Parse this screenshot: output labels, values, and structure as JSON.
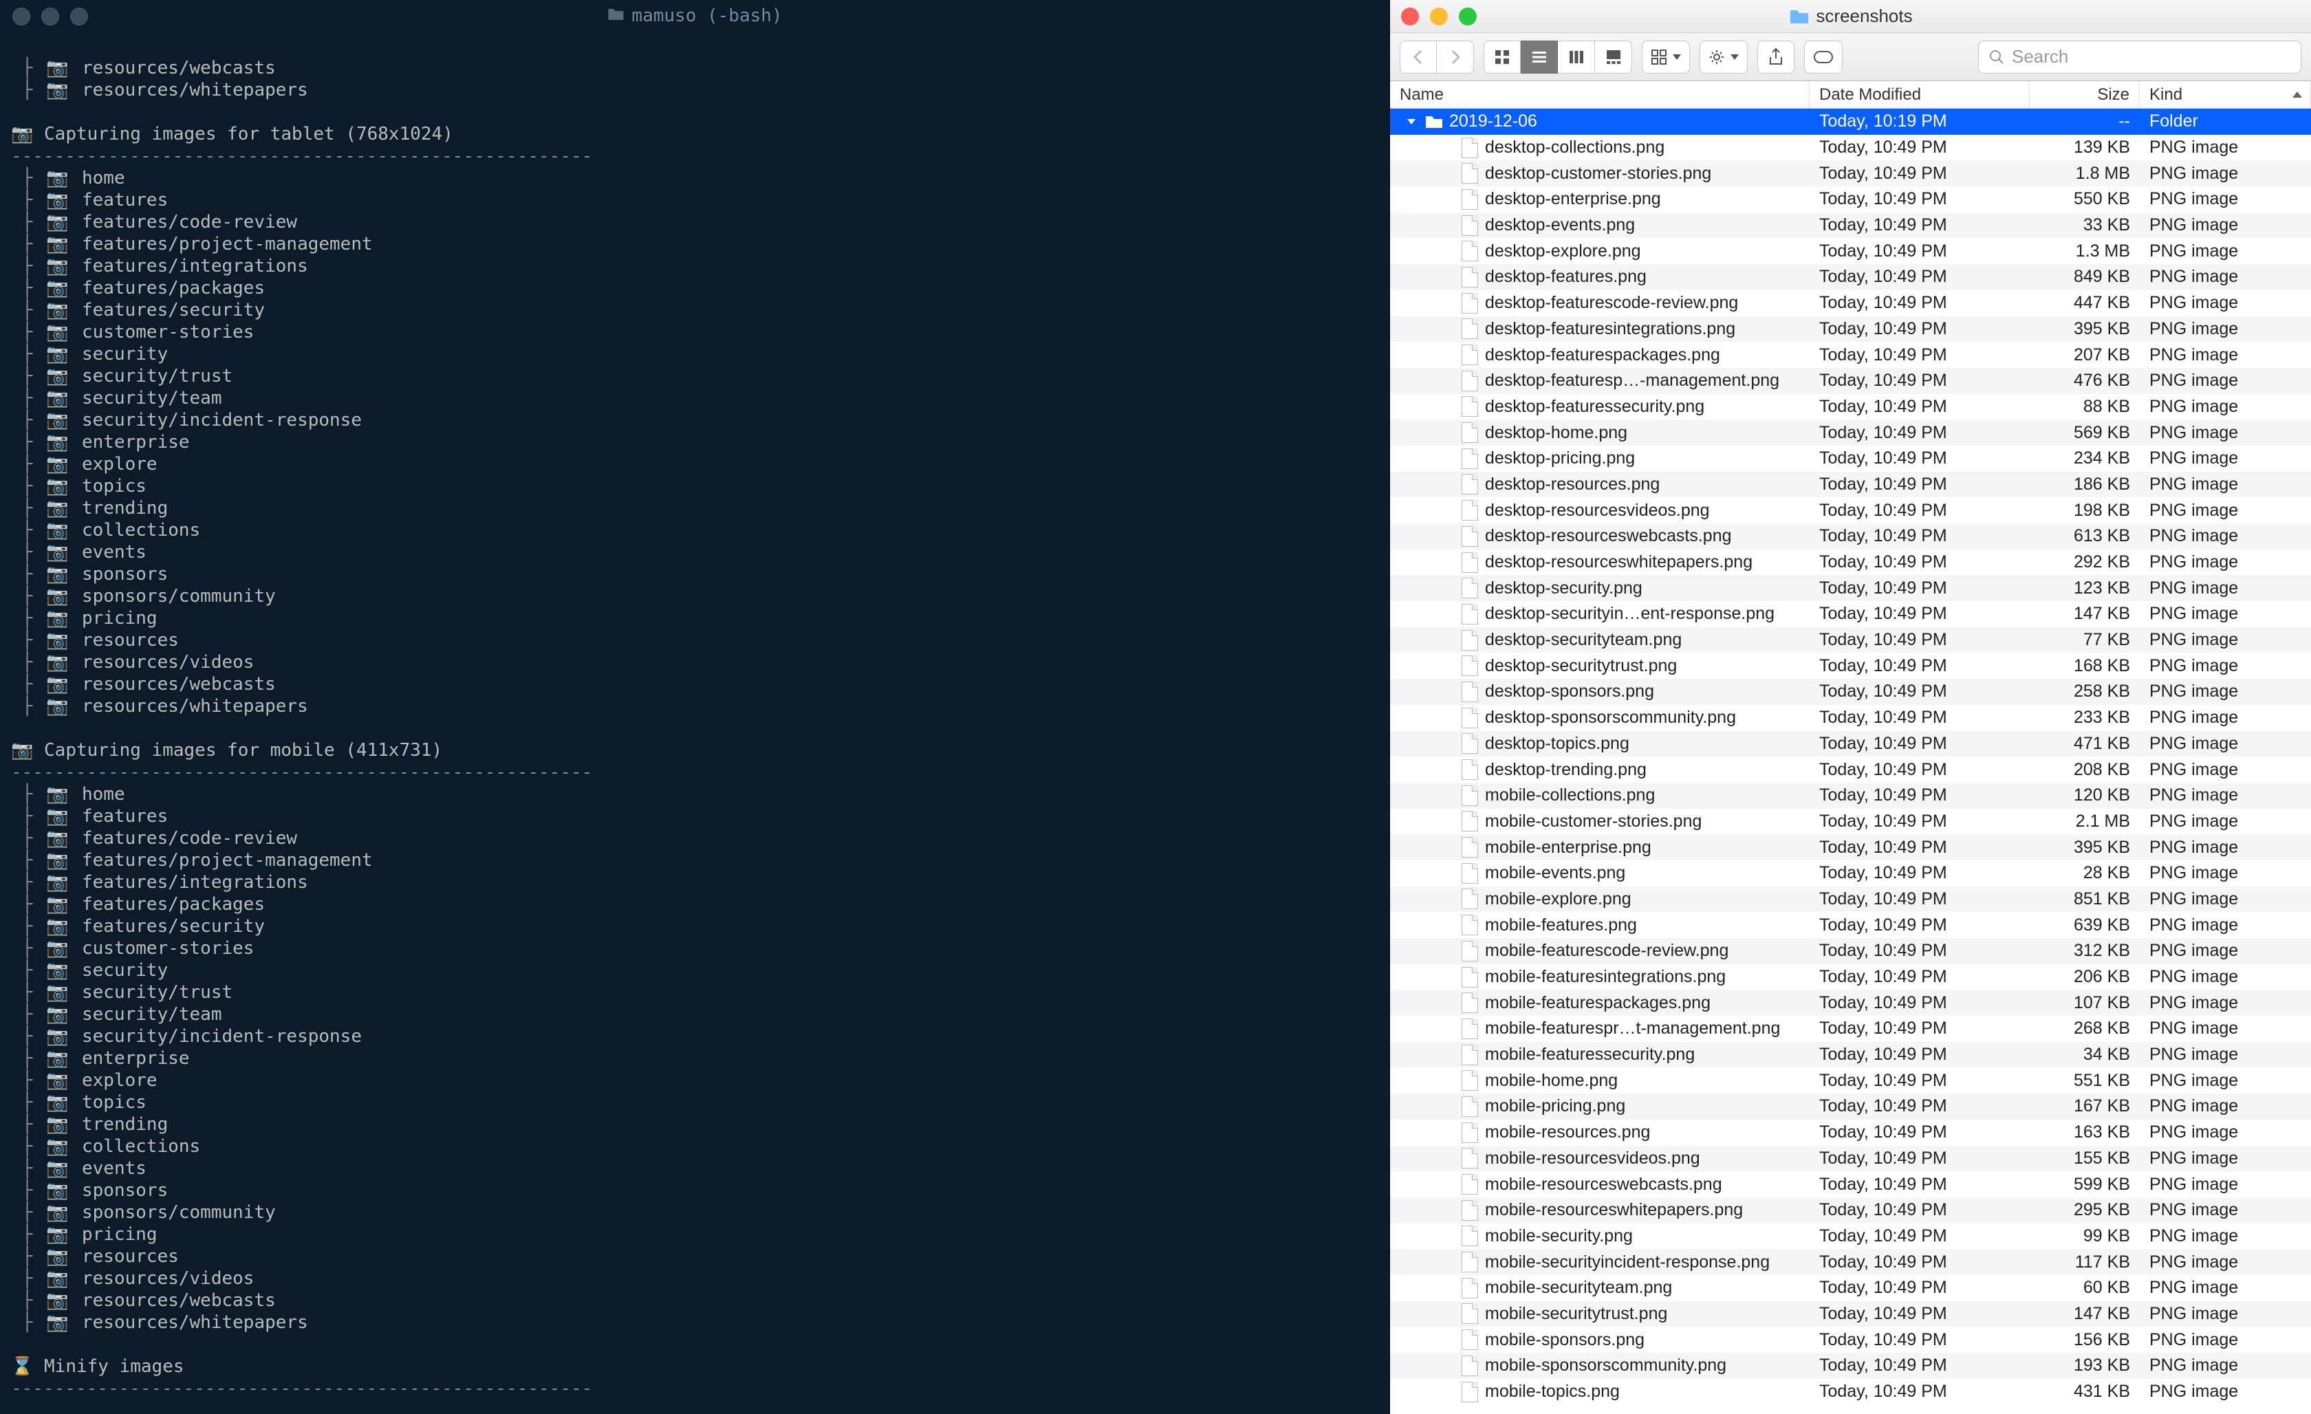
{
  "terminal": {
    "title": "mamuso (-bash)",
    "dashes": "------------------------------------------------------",
    "top_fragment": [
      "resources/webcasts",
      "resources/whitepapers"
    ],
    "sections": [
      {
        "heading": "📷 Capturing images for tablet (768x1024)",
        "items": [
          "home",
          "features",
          "features/code-review",
          "features/project-management",
          "features/integrations",
          "features/packages",
          "features/security",
          "customer-stories",
          "security",
          "security/trust",
          "security/team",
          "security/incident-response",
          "enterprise",
          "explore",
          "topics",
          "trending",
          "collections",
          "events",
          "sponsors",
          "sponsors/community",
          "pricing",
          "resources",
          "resources/videos",
          "resources/webcasts",
          "resources/whitepapers"
        ]
      },
      {
        "heading": "📷 Capturing images for mobile (411x731)",
        "items": [
          "home",
          "features",
          "features/code-review",
          "features/project-management",
          "features/integrations",
          "features/packages",
          "features/security",
          "customer-stories",
          "security",
          "security/trust",
          "security/team",
          "security/incident-response",
          "enterprise",
          "explore",
          "topics",
          "trending",
          "collections",
          "events",
          "sponsors",
          "sponsors/community",
          "pricing",
          "resources",
          "resources/videos",
          "resources/webcasts",
          "resources/whitepapers"
        ]
      }
    ],
    "footer": "⌛ Minify images"
  },
  "finder": {
    "title": "screenshots",
    "search_placeholder": "Search",
    "columns": {
      "name": "Name",
      "date": "Date Modified",
      "size": "Size",
      "kind": "Kind"
    },
    "folder_row": {
      "name": "2019-12-06",
      "date": "Today, 10:19 PM",
      "size": "--",
      "kind": "Folder"
    },
    "file_date": "Today, 10:49 PM",
    "file_kind": "PNG image",
    "files": [
      {
        "name": "desktop-collections.png",
        "size": "139 KB"
      },
      {
        "name": "desktop-customer-stories.png",
        "size": "1.8 MB"
      },
      {
        "name": "desktop-enterprise.png",
        "size": "550 KB"
      },
      {
        "name": "desktop-events.png",
        "size": "33 KB"
      },
      {
        "name": "desktop-explore.png",
        "size": "1.3 MB"
      },
      {
        "name": "desktop-features.png",
        "size": "849 KB"
      },
      {
        "name": "desktop-featurescode-review.png",
        "size": "447 KB"
      },
      {
        "name": "desktop-featuresintegrations.png",
        "size": "395 KB"
      },
      {
        "name": "desktop-featurespackages.png",
        "size": "207 KB"
      },
      {
        "name": "desktop-featuresp…-management.png",
        "size": "476 KB"
      },
      {
        "name": "desktop-featuressecurity.png",
        "size": "88 KB"
      },
      {
        "name": "desktop-home.png",
        "size": "569 KB"
      },
      {
        "name": "desktop-pricing.png",
        "size": "234 KB"
      },
      {
        "name": "desktop-resources.png",
        "size": "186 KB"
      },
      {
        "name": "desktop-resourcesvideos.png",
        "size": "198 KB"
      },
      {
        "name": "desktop-resourceswebcasts.png",
        "size": "613 KB"
      },
      {
        "name": "desktop-resourceswhitepapers.png",
        "size": "292 KB"
      },
      {
        "name": "desktop-security.png",
        "size": "123 KB"
      },
      {
        "name": "desktop-securityin…ent-response.png",
        "size": "147 KB"
      },
      {
        "name": "desktop-securityteam.png",
        "size": "77 KB"
      },
      {
        "name": "desktop-securitytrust.png",
        "size": "168 KB"
      },
      {
        "name": "desktop-sponsors.png",
        "size": "258 KB"
      },
      {
        "name": "desktop-sponsorscommunity.png",
        "size": "233 KB"
      },
      {
        "name": "desktop-topics.png",
        "size": "471 KB"
      },
      {
        "name": "desktop-trending.png",
        "size": "208 KB"
      },
      {
        "name": "mobile-collections.png",
        "size": "120 KB"
      },
      {
        "name": "mobile-customer-stories.png",
        "size": "2.1 MB"
      },
      {
        "name": "mobile-enterprise.png",
        "size": "395 KB"
      },
      {
        "name": "mobile-events.png",
        "size": "28 KB"
      },
      {
        "name": "mobile-explore.png",
        "size": "851 KB"
      },
      {
        "name": "mobile-features.png",
        "size": "639 KB"
      },
      {
        "name": "mobile-featurescode-review.png",
        "size": "312 KB"
      },
      {
        "name": "mobile-featuresintegrations.png",
        "size": "206 KB"
      },
      {
        "name": "mobile-featurespackages.png",
        "size": "107 KB"
      },
      {
        "name": "mobile-featurespr…t-management.png",
        "size": "268 KB"
      },
      {
        "name": "mobile-featuressecurity.png",
        "size": "34 KB"
      },
      {
        "name": "mobile-home.png",
        "size": "551 KB"
      },
      {
        "name": "mobile-pricing.png",
        "size": "167 KB"
      },
      {
        "name": "mobile-resources.png",
        "size": "163 KB"
      },
      {
        "name": "mobile-resourcesvideos.png",
        "size": "155 KB"
      },
      {
        "name": "mobile-resourceswebcasts.png",
        "size": "599 KB"
      },
      {
        "name": "mobile-resourceswhitepapers.png",
        "size": "295 KB"
      },
      {
        "name": "mobile-security.png",
        "size": "99 KB"
      },
      {
        "name": "mobile-securityincident-response.png",
        "size": "117 KB"
      },
      {
        "name": "mobile-securityteam.png",
        "size": "60 KB"
      },
      {
        "name": "mobile-securitytrust.png",
        "size": "147 KB"
      },
      {
        "name": "mobile-sponsors.png",
        "size": "156 KB"
      },
      {
        "name": "mobile-sponsorscommunity.png",
        "size": "193 KB"
      },
      {
        "name": "mobile-topics.png",
        "size": "431 KB"
      }
    ]
  }
}
